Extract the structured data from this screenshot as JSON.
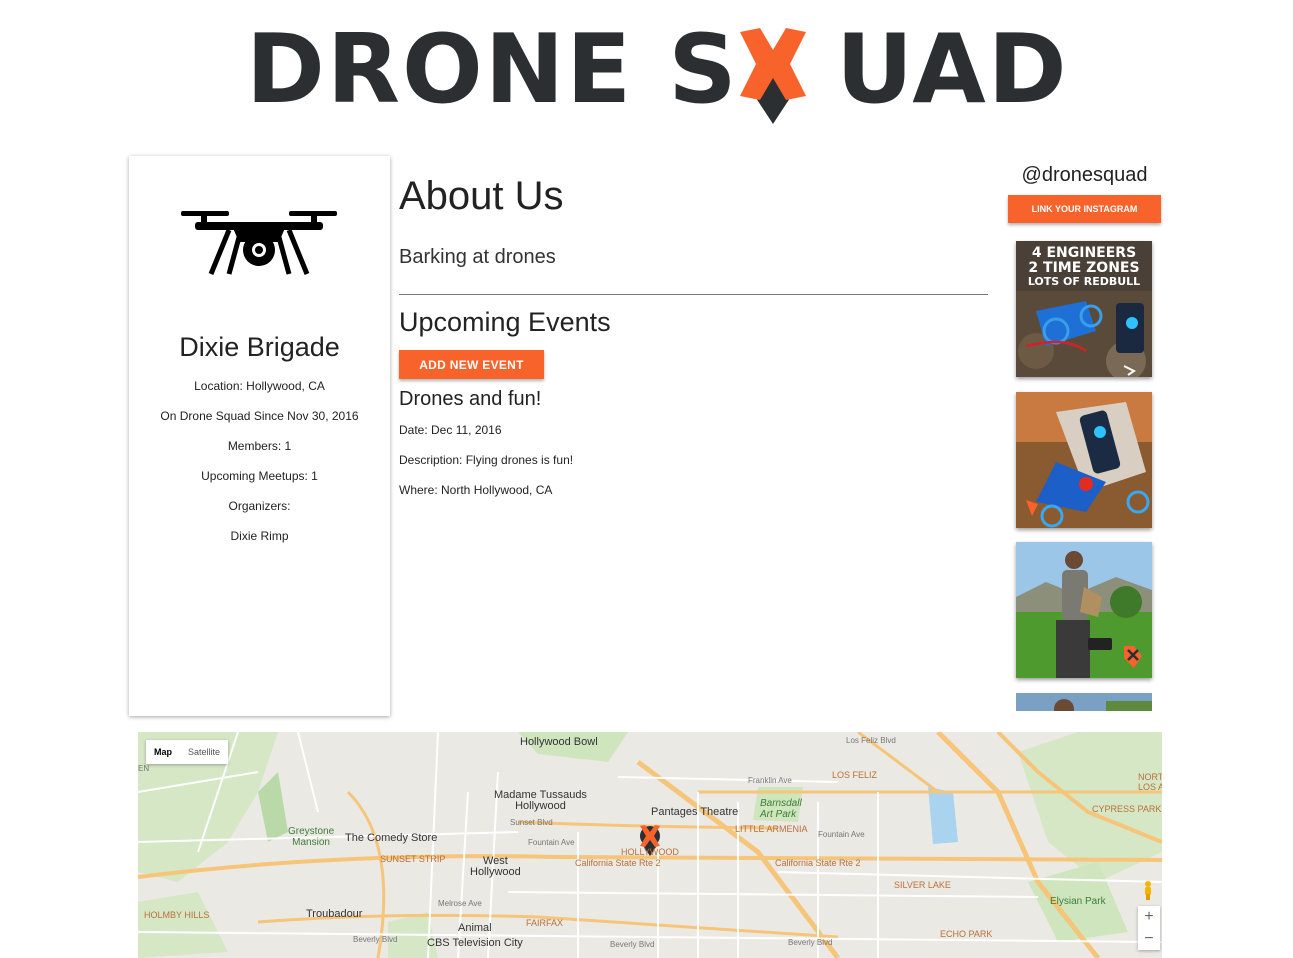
{
  "logo": {
    "left_text": "DRONE S",
    "right_text": "UAD",
    "brand_dark": "#2b2f32",
    "brand_orange": "#f8622b"
  },
  "profile": {
    "name": "Dixie Brigade",
    "avatar_icon": "quadcopter-drone-icon",
    "location": "Location: Hollywood, CA",
    "since": "On Drone Squad Since Nov 30, 2016",
    "members": "Members: 1",
    "upcoming_meetups": "Upcoming Meetups: 1",
    "organizers_label": "Organizers:",
    "organizer": "Dixie Rimp"
  },
  "about": {
    "title": "About Us",
    "text": "Barking at drones"
  },
  "events": {
    "title": "Upcoming Events",
    "add_button": "ADD NEW EVENT",
    "items": [
      {
        "name": "Drones and fun!",
        "date": "Date: Dec 11, 2016",
        "description": "Description: Flying drones is fun!",
        "where": "Where: North Hollywood, CA"
      }
    ]
  },
  "instagram": {
    "handle": "@dronesquad",
    "link_button": "LINK YOUR INSTAGRAM",
    "photo1_caption": [
      "4 ENGINEERS",
      "2 TIME ZONES",
      "LOTS OF REDBULL"
    ]
  },
  "map": {
    "type_options": [
      "Map",
      "Satellite"
    ],
    "selected_type": "Map",
    "zoom_in": "+",
    "zoom_out": "−",
    "labels": {
      "hollywood_bowl": "Hollywood Bowl",
      "madame_tussauds": "Madame Tussauds\nHollywood",
      "pantages": "Pantages Theatre",
      "barnsdall": "Barnsdall\nArt Park",
      "little_armenia": "LITTLE ARMENIA",
      "los_feliz": "LOS FELIZ",
      "franklin": "Franklin Ave",
      "greystone": "Greystone\nMansion",
      "comedy_store": "The Comedy Store",
      "sunset_strip": "SUNSET STRIP",
      "west_hollywood": "West\nHollywood",
      "hollywood": "HOLLYWOOD",
      "ca_rte2_a": "California State Rte 2",
      "ca_rte2_b": "California State Rte 2",
      "silver_lake": "SILVER LAKE",
      "elysian": "Elysian Park",
      "echo_park": "ECHO PARK",
      "cypress_park": "CYPRESS PARK",
      "north_los": "NORT\nLOS A",
      "beverly_hills": "HOLMBY HILLS",
      "troubadour": "Troubadour",
      "animal": "Animal",
      "cbs": "CBS Television City",
      "fairfax": "FAIRFAX",
      "sunset_blvd": "Sunset Blvd",
      "fountain_ave": "Fountain Ave",
      "melrose": "Melrose Ave",
      "beverly_blvd": "Beverly Blvd",
      "beverly_blvd2": "Beverly Blvd",
      "beverly_blvd3": "Beverly Blvd",
      "fountain_ave2": "Fountain Ave",
      "los_feliz_blvd": "Los Feliz Blvd",
      "en": "EN"
    }
  }
}
